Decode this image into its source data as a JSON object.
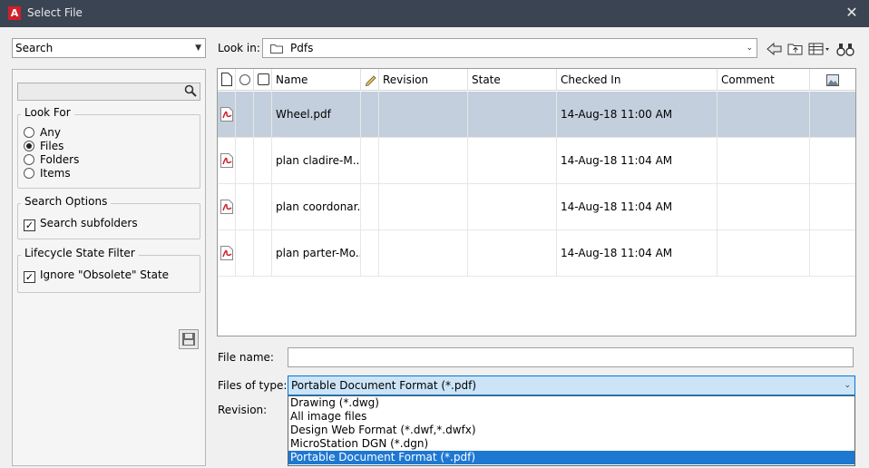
{
  "window": {
    "app_icon_glyph": "A",
    "title": "Select File",
    "close_glyph": "✕"
  },
  "left": {
    "mode_select": "Search",
    "search_placeholder": "",
    "look_for": {
      "title": "Look For",
      "options": [
        {
          "label": "Any",
          "selected": false
        },
        {
          "label": "Files",
          "selected": true
        },
        {
          "label": "Folders",
          "selected": false
        },
        {
          "label": "Items",
          "selected": false
        }
      ]
    },
    "search_options": {
      "title": "Search Options",
      "subfolders_label": "Search subfolders",
      "subfolders_checked": true
    },
    "lifecycle": {
      "title": "Lifecycle State Filter",
      "obsolete_label": "Ignore \"Obsolete\" State",
      "obsolete_checked": true
    }
  },
  "lookin": {
    "label": "Look in:",
    "value": "Pdfs"
  },
  "columns": {
    "name": "Name",
    "revision": "Revision",
    "state": "State",
    "checked_in": "Checked In",
    "comment": "Comment"
  },
  "files": [
    {
      "name": "Wheel.pdf",
      "revision": "",
      "state": "",
      "checked_in": "14-Aug-18 11:00 AM",
      "comment": "",
      "selected": true
    },
    {
      "name": "plan cladire-M...",
      "revision": "",
      "state": "",
      "checked_in": "14-Aug-18 11:04 AM",
      "comment": "",
      "selected": false
    },
    {
      "name": "plan coordonar...",
      "revision": "",
      "state": "",
      "checked_in": "14-Aug-18 11:04 AM",
      "comment": "",
      "selected": false
    },
    {
      "name": "plan parter-Mo...",
      "revision": "",
      "state": "",
      "checked_in": "14-Aug-18 11:04 AM",
      "comment": "",
      "selected": false
    }
  ],
  "form": {
    "file_name_label": "File name:",
    "file_name_value": "",
    "files_of_type_label": "Files of type:",
    "files_of_type_value": "Portable Document Format (*.pdf)",
    "revision_label": "Revision:"
  },
  "type_options": [
    {
      "label": "Drawing (*.dwg)",
      "selected": false
    },
    {
      "label": "All image files",
      "selected": false
    },
    {
      "label": "Design Web Format (*.dwf,*.dwfx)",
      "selected": false
    },
    {
      "label": "MicroStation DGN (*.dgn)",
      "selected": false
    },
    {
      "label": "Portable Document Format (*.pdf)",
      "selected": true
    }
  ],
  "colors": {
    "titlebar": "#3b4453",
    "selected_row": "#c3cfdc",
    "dropdown_highlight": "#1e78d2",
    "pdf_red": "#d21f2a"
  }
}
